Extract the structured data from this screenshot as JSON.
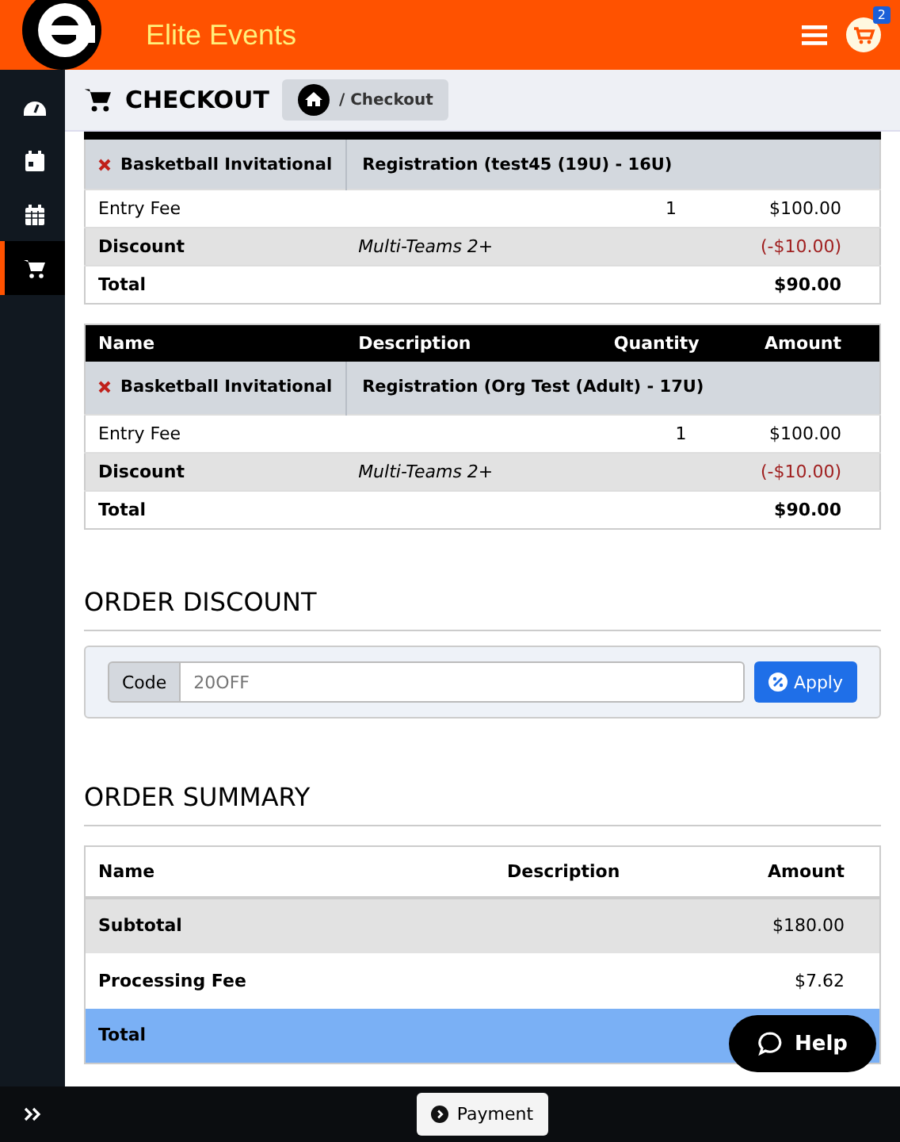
{
  "brand": {
    "name": "Elite Events"
  },
  "header": {
    "cart_count": "2"
  },
  "sidebar": {
    "items": [
      {
        "kind": "dashboard",
        "selected": false
      },
      {
        "kind": "event",
        "selected": false
      },
      {
        "kind": "calendar",
        "selected": false
      },
      {
        "kind": "cart",
        "selected": true
      }
    ]
  },
  "page": {
    "title": "CHECKOUT",
    "breadcrumb": "/ Checkout"
  },
  "order_tables": [
    {
      "item": "Basketball Invitational",
      "registration": "Registration (test45 (19U) - 16U)",
      "lines": [
        {
          "kind": "fee",
          "name": "Entry Fee",
          "quantity": "1",
          "amount": "$100.00"
        },
        {
          "kind": "discount",
          "name": "Discount",
          "description": "Multi-Teams 2+",
          "amount": "(-$10.00)"
        },
        {
          "kind": "total",
          "name": "Total",
          "amount": "$90.00"
        }
      ]
    },
    {
      "columns": [
        "Name",
        "Description",
        "Quantity",
        "Amount"
      ],
      "item": "Basketball Invitational",
      "registration": "Registration (Org Test (Adult) - 17U)",
      "lines": [
        {
          "kind": "fee",
          "name": "Entry Fee",
          "quantity": "1",
          "amount": "$100.00"
        },
        {
          "kind": "discount",
          "name": "Discount",
          "description": "Multi-Teams 2+",
          "amount": "(-$10.00)"
        },
        {
          "kind": "total",
          "name": "Total",
          "amount": "$90.00"
        }
      ]
    }
  ],
  "order_discount": {
    "title": "ORDER DISCOUNT",
    "label": "Code",
    "placeholder": "20OFF",
    "button": "Apply"
  },
  "order_summary": {
    "title": "ORDER SUMMARY",
    "columns": [
      "Name",
      "Description",
      "Amount"
    ],
    "rows": [
      {
        "kind": "subtotal",
        "name": "Subtotal",
        "amount": "$180.00"
      },
      {
        "kind": "fee",
        "name": "Processing Fee",
        "amount": "$7.62"
      },
      {
        "kind": "total",
        "name": "Total"
      }
    ]
  },
  "help_button": "Help",
  "footer": {
    "button": "Payment"
  }
}
